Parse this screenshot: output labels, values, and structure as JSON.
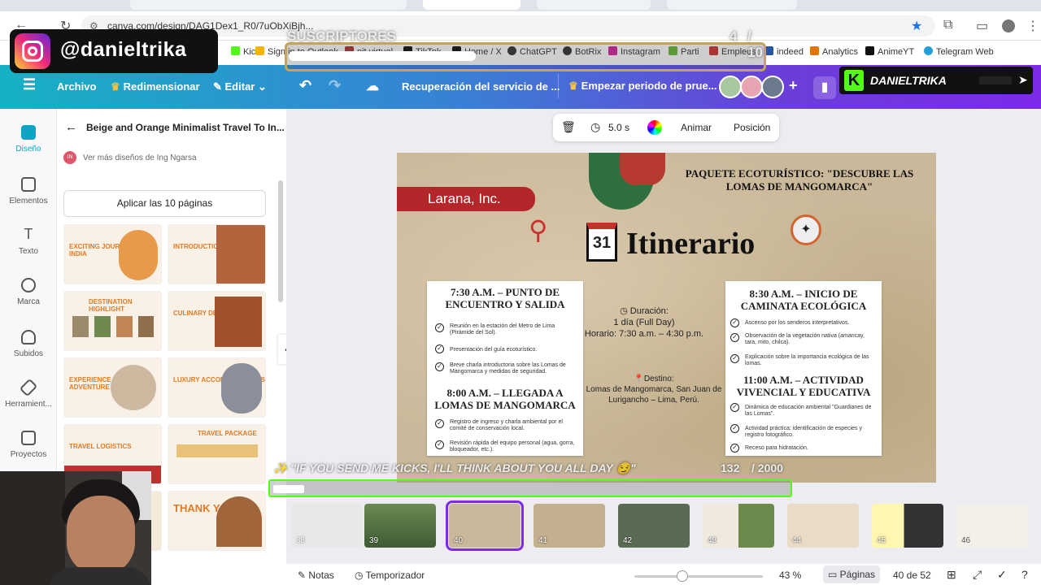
{
  "browser": {
    "url": "canva.com/design/DAG1Dex1_R0/7uObXiBjh...",
    "bookmarks": [
      "Kick",
      "Sign in to Outlook",
      "pit virtual",
      "TikTok",
      "Home / X",
      "ChatGPT",
      "BotRix",
      "Instagram",
      "Parti",
      "Empleos",
      "indeed",
      "Analytics",
      "AnimeYT",
      "Telegram Web"
    ]
  },
  "overlay": {
    "instagram_handle": "@danieltrika",
    "subscribers_label": "SUSCRIPTORES",
    "subscribers_count": "4",
    "subscribers_goal": "/ 10",
    "kick_name": "DANIELTRIKA",
    "kicks_message": "\"IF YOU SEND ME KICKS, I'LL THINK ABOUT YOU ALL DAY 😏\"",
    "kicks_count": "132",
    "kicks_goal": "/ 2000"
  },
  "canva_bar": {
    "archivo": "Archivo",
    "redimensionar": "Redimensionar",
    "editar": "Editar",
    "recovery": "Recuperación del servicio de ...",
    "trial": "Empezar periodo de prue..."
  },
  "rail": [
    "Diseño",
    "Elementos",
    "Texto",
    "Marca",
    "Subidos",
    "Herramient...",
    "Proyectos"
  ],
  "panel": {
    "title": "Beige and Orange Minimalist Travel To In...",
    "author": "Ver más diseños de Ing Ngarsa",
    "author_initials": "IN",
    "apply_button": "Aplicar las 10 páginas",
    "thumbnails": [
      "EXCITING JOURNEY TO INDIA",
      "INTRODUCTION",
      "DESTINATION HIGHLIGHT",
      "CULINARY DELIGHTS",
      "EXPERIENCE THE NEW ADVENTURE",
      "LUXURY ACCOMMODATIONS",
      "TRAVEL LOGISTICS",
      "TRAVEL PACKAGE",
      "",
      "THANK YOU"
    ]
  },
  "toolbar": {
    "duration": "5.0 s",
    "animar": "Animar",
    "posicion": "Posición"
  },
  "slide": {
    "company": "Larana, Inc.",
    "package_title": "PAQUETE ECOTURÍSTICO: \"DESCUBRE LAS LOMAS DE MANGOMARCA\"",
    "heading": "Itinerario",
    "calendar_day": "31",
    "left_card": {
      "time1": "7:30 A.M. – PUNTO DE ENCUENTRO Y SALIDA",
      "items1": [
        "Reunión en la estación del Metro de Lima (Pirámide del Sol).",
        "Presentación del guía ecoturístico.",
        "Breve charla introductoria sobre las Lomas de Mangomarca y medidas de seguridad."
      ],
      "time2": "8:00 A.M. – LLEGADA A LOMAS DE MANGOMARCA",
      "items2": [
        "Registro de ingreso y charla ambiental por el comité de conservación local.",
        "Revisión rápida del equipo personal (agua, gorra, bloqueador, etc.)."
      ]
    },
    "center": {
      "duracion_label": "Duración:",
      "duracion_value": "1 día (Full Day)",
      "horario": "Horario: 7:30 a.m. – 4:30 p.m.",
      "destino_label": "Destino:",
      "destino_value": "Lomas de Mangomarca, San Juan de Lurigancho – Lima, Perú."
    },
    "right_card": {
      "time1": "8:30 A.M. – INICIO DE CAMINATA ECOLÓGICA",
      "items1": [
        "Ascenso por los senderos interpretativos.",
        "Observación de la vegetación nativa (amancay, tara, mito, chilca).",
        "Explicación sobre la importancia ecológica de las lomas."
      ],
      "time2": "11:00 A.M. – ACTIVIDAD VIVENCIAL Y EDUCATIVA",
      "items2": [
        "Dinámica de educación ambiental \"Guardianes de las Lomas\".",
        "Actividad práctica: identificación de especies y registro fotográfico.",
        "Receso para hidratación."
      ]
    }
  },
  "filmstrip": {
    "pages": [
      "38",
      "39",
      "40",
      "41",
      "42",
      "43",
      "44",
      "45",
      "46"
    ],
    "selected": "40"
  },
  "bottom": {
    "notas": "Notas",
    "temporizador": "Temporizador",
    "zoom": "43 %",
    "paginas": "Páginas",
    "page_count": "40 de 52"
  },
  "colors": {
    "accent": "#7d2ae8",
    "slide_red": "#b3262a",
    "paper": "#c9b899"
  }
}
